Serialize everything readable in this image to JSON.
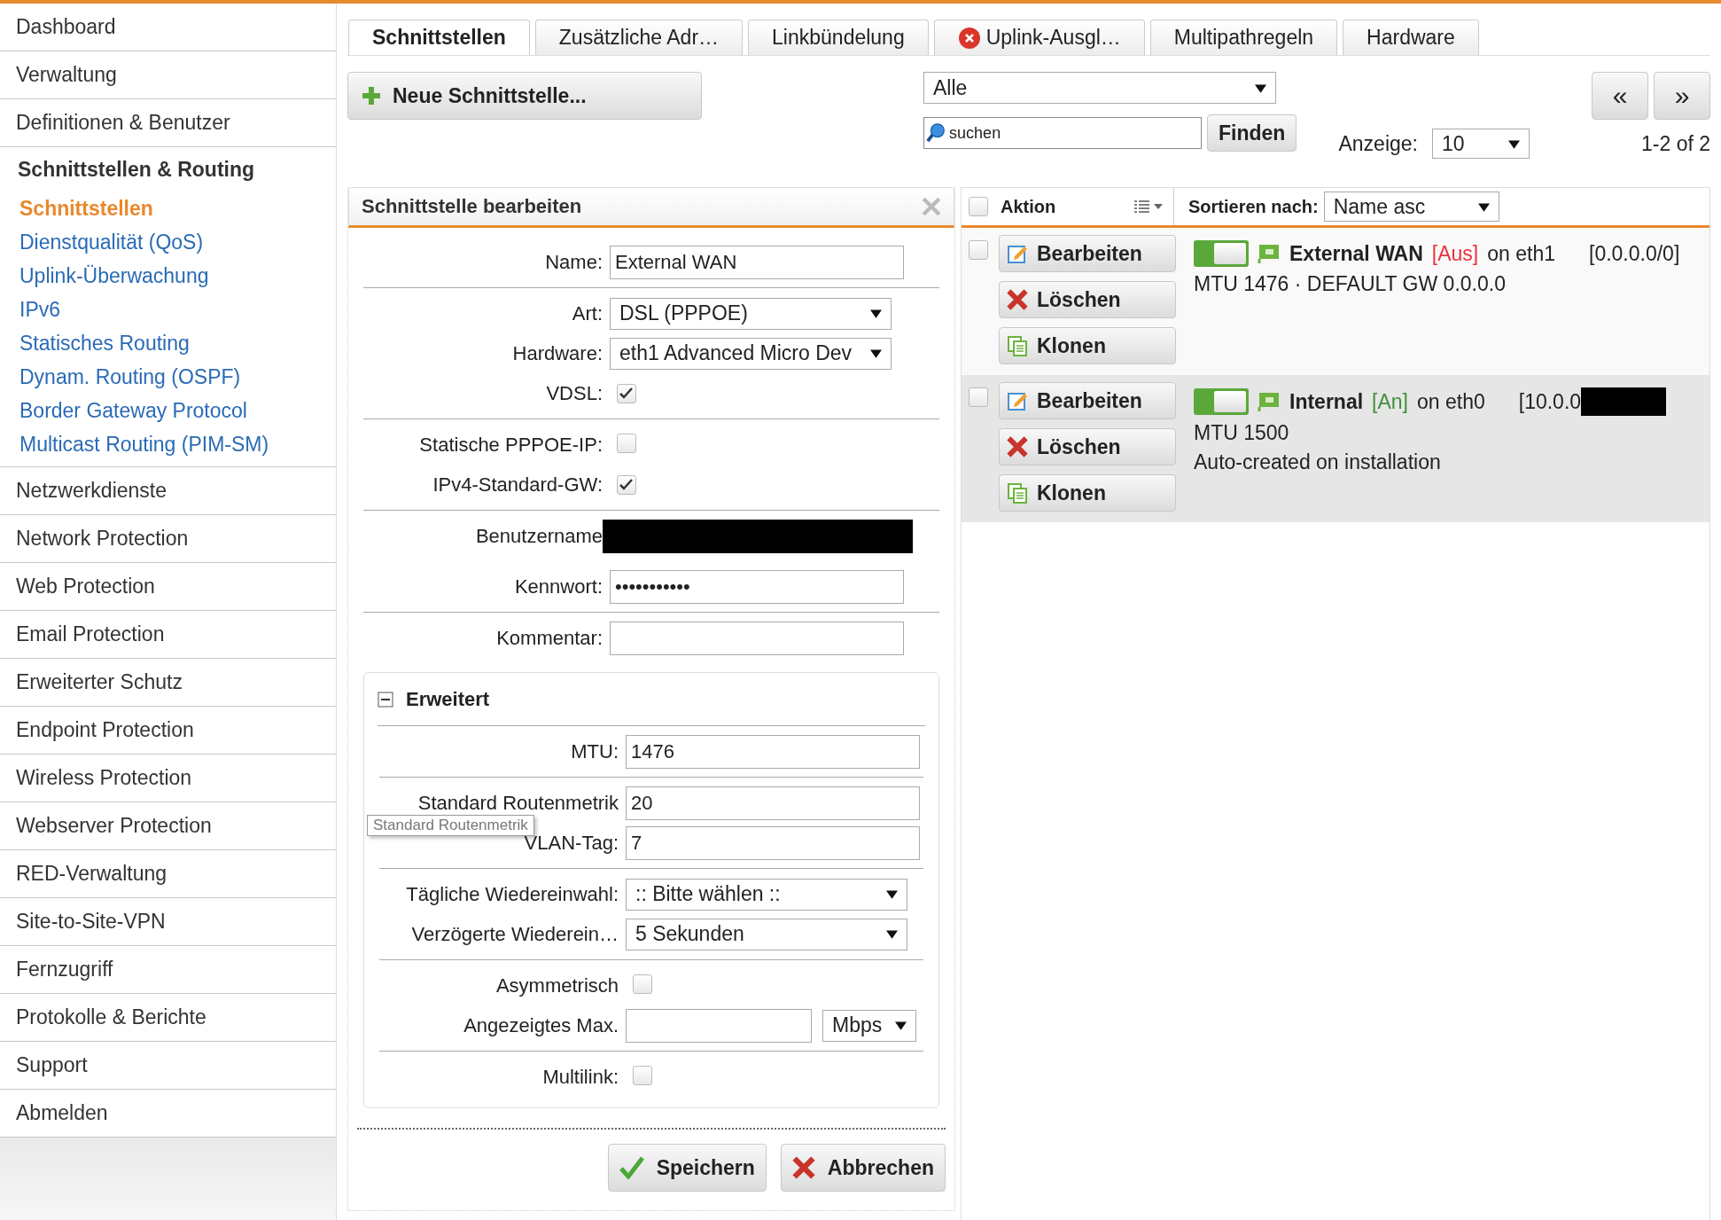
{
  "sidebar": {
    "items": [
      {
        "label": "Dashboard",
        "selected": false
      },
      {
        "label": "Verwaltung",
        "selected": false
      },
      {
        "label": "Definitionen & Benutzer",
        "selected": false
      },
      {
        "label": "Schnittstellen & Routing",
        "selected": false,
        "expanded": true,
        "children": [
          {
            "label": "Schnittstellen",
            "selected": true
          },
          {
            "label": "Dienstqualität (QoS)",
            "selected": false
          },
          {
            "label": "Uplink-Überwachung",
            "selected": false
          },
          {
            "label": "IPv6",
            "selected": false
          },
          {
            "label": "Statisches Routing",
            "selected": false
          },
          {
            "label": "Dynam. Routing (OSPF)",
            "selected": false
          },
          {
            "label": "Border Gateway Protocol",
            "selected": false
          },
          {
            "label": "Multicast Routing (PIM-SM)",
            "selected": false
          }
        ]
      },
      {
        "label": "Netzwerkdienste",
        "selected": false
      },
      {
        "label": "Network Protection",
        "selected": false
      },
      {
        "label": "Web Protection",
        "selected": false
      },
      {
        "label": "Email Protection",
        "selected": false
      },
      {
        "label": "Erweiterter Schutz",
        "selected": false
      },
      {
        "label": "Endpoint Protection",
        "selected": false
      },
      {
        "label": "Wireless Protection",
        "selected": false
      },
      {
        "label": "Webserver Protection",
        "selected": false
      },
      {
        "label": "RED-Verwaltung",
        "selected": false
      },
      {
        "label": "Site-to-Site-VPN",
        "selected": false
      },
      {
        "label": "Fernzugriff",
        "selected": false
      },
      {
        "label": "Protokolle & Berichte",
        "selected": false
      },
      {
        "label": "Support",
        "selected": false
      },
      {
        "label": "Abmelden",
        "selected": false
      }
    ]
  },
  "tabs": [
    {
      "label": "Schnittstellen",
      "selected": true,
      "error": false
    },
    {
      "label": "Zusätzliche Adr…",
      "selected": false,
      "error": false
    },
    {
      "label": "Linkbündelung",
      "selected": false,
      "error": false
    },
    {
      "label": "Uplink-Ausgl…",
      "selected": false,
      "error": true
    },
    {
      "label": "Multipathregeln",
      "selected": false,
      "error": false
    },
    {
      "label": "Hardware",
      "selected": false,
      "error": false
    }
  ],
  "toolbar": {
    "new_button": "Neue Schnittstelle...",
    "filter": "Alle",
    "search": {
      "placeholder": "suchen"
    },
    "find_button": "Finden",
    "display_label": "Anzeige:",
    "display_value": "10",
    "prev": "«",
    "next": "»",
    "range": "1-2 of 2"
  },
  "form": {
    "title": "Schnittstelle bearbeiten",
    "groups": [
      [
        {
          "kind": "text",
          "label": "Name:",
          "value": "External WAN"
        }
      ],
      [
        {
          "kind": "select",
          "label": "Art:",
          "value": "DSL (PPPOE)"
        },
        {
          "kind": "select",
          "label": "Hardware:",
          "value": "eth1 Advanced Micro Dev"
        },
        {
          "kind": "checkbox",
          "label": "VDSL:",
          "checked": true
        }
      ],
      [
        {
          "kind": "checkbox",
          "label": "Statische PPPOE-IP:",
          "checked": false
        },
        {
          "kind": "checkbox",
          "label": "IPv4-Standard-GW:",
          "checked": true
        }
      ],
      [
        {
          "kind": "redacted",
          "label": "Benutzername"
        }
      ],
      [
        {
          "kind": "password",
          "label": "Kennwort:",
          "value": "•••••••••••"
        }
      ],
      [
        {
          "kind": "text",
          "label": "Kommentar:"
        }
      ]
    ],
    "advanced": {
      "title": "Erweitert",
      "expanded": true,
      "groups": [
        [
          {
            "kind": "text",
            "label": "MTU:",
            "value": "1476"
          }
        ],
        [
          {
            "kind": "text",
            "label": "Standard Routenmetrik",
            "value": "20"
          },
          {
            "kind": "text",
            "label": "VLAN-Tag:",
            "value": "7"
          }
        ],
        [
          {
            "kind": "select",
            "label": "Tägliche Wiedereinwahl:",
            "value": ":: Bitte wählen ::"
          },
          {
            "kind": "select",
            "label": "Verzögerte Wiederein…",
            "value": "5 Sekunden"
          }
        ],
        [
          {
            "kind": "checkbox",
            "label": "Asymmetrisch",
            "checked": false
          },
          {
            "kind": "unit",
            "label": "Angezeigtes Max.",
            "unit": "Mbps"
          }
        ],
        [
          {
            "kind": "checkbox",
            "label": "Multilink:",
            "checked": false
          }
        ]
      ]
    },
    "tooltip": "Standard Routenmetrik",
    "buttons": [
      {
        "kind": "save",
        "label": "Speichern"
      },
      {
        "kind": "cancel",
        "label": "Abbrechen"
      }
    ]
  },
  "list": {
    "action_label": "Aktion",
    "sort_label": "Sortieren nach:",
    "sort_value": "Name asc",
    "all_checked": false,
    "rows": [
      {
        "selected": false,
        "checked": false,
        "on": true,
        "name": "External WAN",
        "status": "[Aus]",
        "color": "#e8333a",
        "iface": "on eth1",
        "address": "[0.0.0.0/0]",
        "redacted": false,
        "lines": [
          "MTU 1476 · DEFAULT GW 0.0.0.0"
        ],
        "actions": [
          {
            "kind": "edit",
            "label": "Bearbeiten"
          },
          {
            "kind": "delete",
            "label": "Löschen"
          },
          {
            "kind": "clone",
            "label": "Klonen"
          }
        ]
      },
      {
        "selected": true,
        "checked": false,
        "on": true,
        "name": "Internal",
        "status": "[An]",
        "color": "#3f8f3a",
        "iface": "on eth0",
        "address": "[10.0.0",
        "redacted": true,
        "lines": [
          "MTU 1500",
          "Auto-created on installation"
        ],
        "actions": [
          {
            "kind": "edit",
            "label": "Bearbeiten"
          },
          {
            "kind": "delete",
            "label": "Löschen"
          },
          {
            "kind": "clone",
            "label": "Klonen"
          }
        ]
      }
    ]
  }
}
